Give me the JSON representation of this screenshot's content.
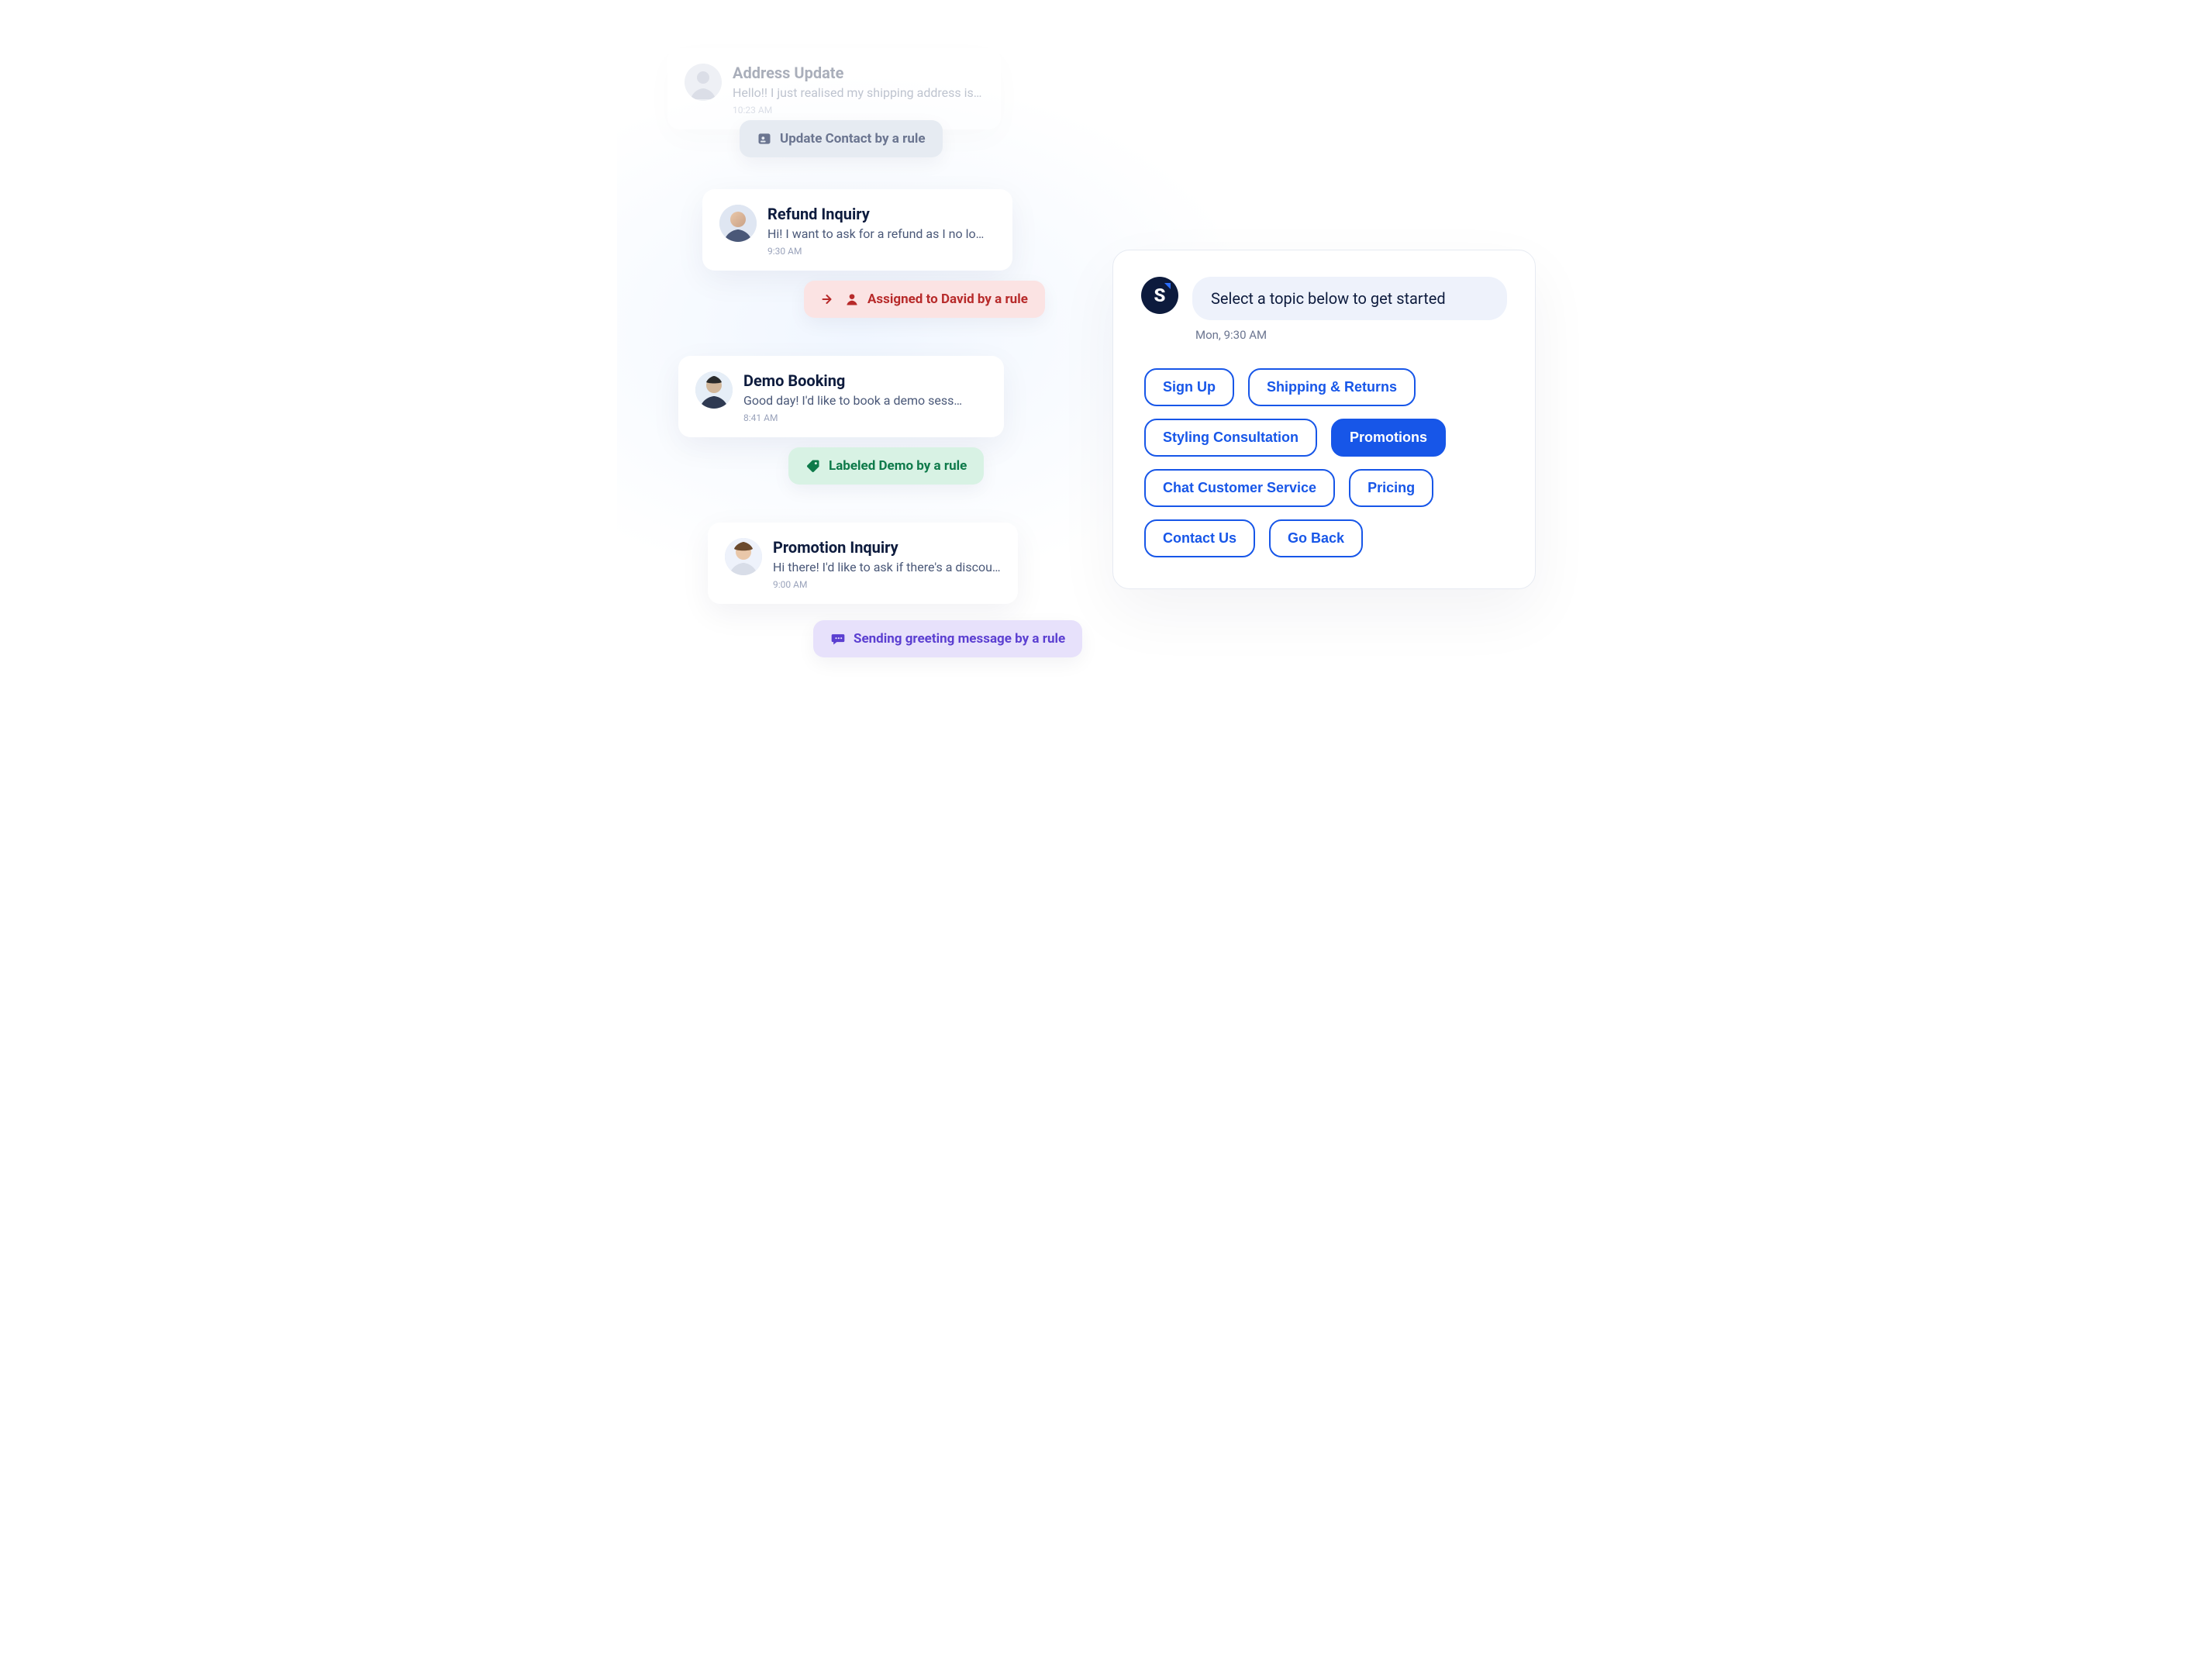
{
  "conversations": [
    {
      "title": "Address Update",
      "snippet": "Hello!! I just realised my shipping address is wrong…",
      "time": "10:23 AM",
      "rule": {
        "label": "Update Contact by a rule",
        "variant": "grey",
        "icon": "contact-card"
      }
    },
    {
      "title": "Refund Inquiry",
      "snippet": "Hi! I want to ask for a refund as I no lo…",
      "time": "9:30 AM",
      "rule": {
        "label": "Assigned to David by a rule",
        "variant": "red",
        "icon": "arrow-user"
      }
    },
    {
      "title": "Demo Booking",
      "snippet": "Good day! I'd like to book a demo sess…",
      "time": "8:41 AM",
      "rule": {
        "label": "Labeled Demo by a rule",
        "variant": "green",
        "icon": "tag"
      }
    },
    {
      "title": "Promotion Inquiry",
      "snippet": "Hi there! I'd like to ask if there's a discount…",
      "time": "9:00 AM",
      "rule": {
        "label": "Sending greeting message by a rule",
        "variant": "purple",
        "icon": "chat"
      }
    }
  ],
  "chat": {
    "bot_initial": "S",
    "prompt": "Select a topic below to get started",
    "timestamp": "Mon, 9:30 AM",
    "topics": [
      {
        "label": "Sign Up",
        "selected": false
      },
      {
        "label": "Shipping & Returns",
        "selected": false
      },
      {
        "label": "Styling Consultation",
        "selected": false
      },
      {
        "label": "Promotions",
        "selected": true
      },
      {
        "label": "Chat Customer Service",
        "selected": false
      },
      {
        "label": "Pricing",
        "selected": false
      },
      {
        "label": "Contact Us",
        "selected": false
      },
      {
        "label": "Go Back",
        "selected": false
      }
    ]
  },
  "colors": {
    "brand_blue": "#1756e8",
    "badge_grey_bg": "#e6ebf2",
    "badge_grey_fg": "#6b7590",
    "badge_red_bg": "#fbe3e3",
    "badge_red_fg": "#b72a2a",
    "badge_green_bg": "#d8f2e4",
    "badge_green_fg": "#0e7a4a",
    "badge_purple_bg": "#e7e1fb",
    "badge_purple_fg": "#5b3fd1"
  }
}
